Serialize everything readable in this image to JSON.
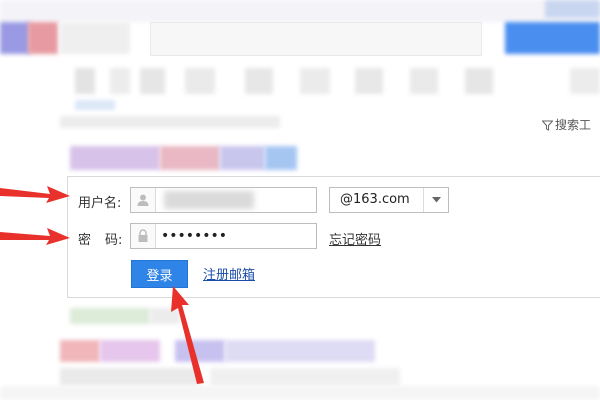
{
  "toolbar": {
    "filter_label": "搜索工"
  },
  "login": {
    "username_label": "用户名:",
    "password_label_1": "密",
    "password_label_2": "码:",
    "password_mask": "••••••••",
    "domain": "@163.com",
    "forgot_label": "忘记密码",
    "login_label": "登录",
    "register_label": "注册邮箱"
  },
  "colors": {
    "accent": "#2f84e8",
    "arrow": "#e8312a",
    "link": "#1a4ea8"
  }
}
